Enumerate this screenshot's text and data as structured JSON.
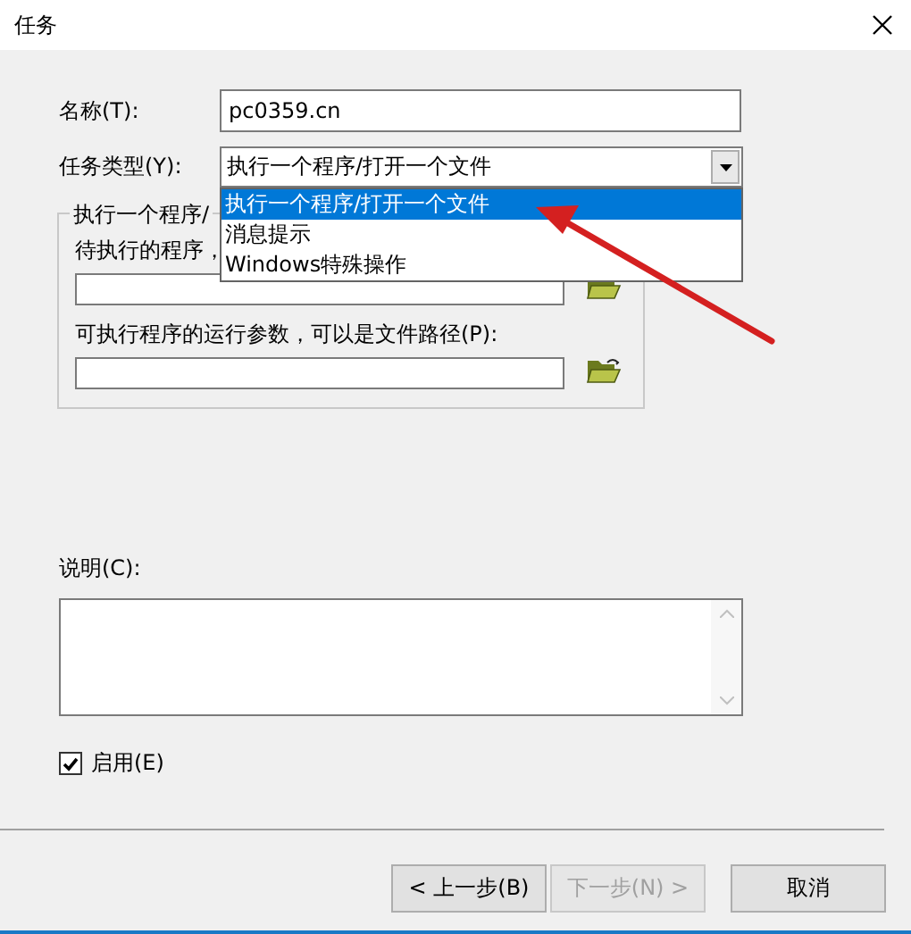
{
  "window": {
    "title": "任务"
  },
  "name_field": {
    "label": "名称(T):",
    "value": "pc0359.cn"
  },
  "task_type": {
    "label": "任务类型(Y):",
    "value": "执行一个程序/打开一个文件",
    "expanded": true,
    "options": [
      {
        "label": "执行一个程序/打开一个文件",
        "selected": true
      },
      {
        "label": "消息提示",
        "selected": false
      },
      {
        "label": "Windows特殊操作",
        "selected": false
      }
    ]
  },
  "program_group": {
    "title": "执行一个程序/",
    "program_label": "待执行的程序，",
    "args_label": "可执行程序的运行参数，可以是文件路径(P):"
  },
  "description": {
    "label": "说明(C):"
  },
  "enabled": {
    "label": "启用(E)",
    "checked": true
  },
  "buttons": [
    {
      "label": "< 上一步(B)",
      "disabled": false
    },
    {
      "label": "下一步(N) >",
      "disabled": true
    },
    {
      "label": "取消",
      "disabled": false
    }
  ]
}
